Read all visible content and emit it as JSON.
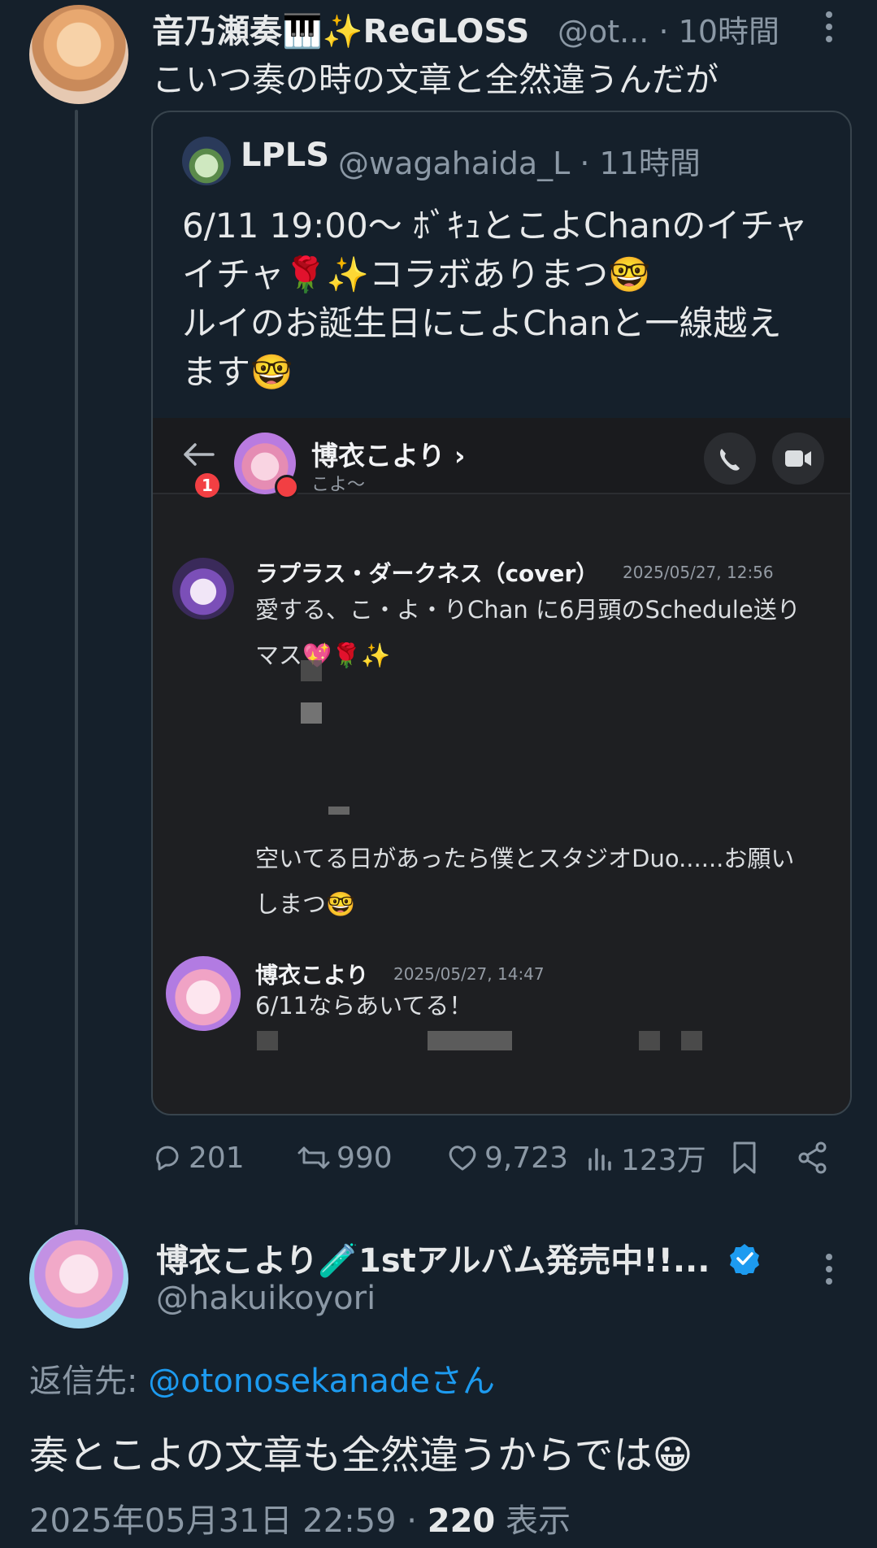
{
  "tweet1": {
    "display_name": "音乃瀬奏🎹✨ReGLOSS",
    "handle": "@ot...",
    "time": "· 10時間",
    "text": "こいつ奏の時の文章と全然違うんだが"
  },
  "quote": {
    "display_name": "LPLS",
    "handle": "@wagahaida_L · 11時間",
    "lines": [
      "6/11 19:00〜 ﾎﾞｷｭとこよChanのイチャ",
      "イチャ🌹✨コラボありまつ🤓",
      "ルイのお誕生日にこよChanと一線越え",
      "ます🤓"
    ]
  },
  "chat": {
    "badge": "1",
    "channel_name": "博衣こより ›",
    "channel_sub": "こよ〜",
    "msg1": {
      "name": "ラプラス・ダークネス（cover）",
      "time": "2025/05/27, 12:56",
      "lines": [
        "愛する、こ・よ・りChan に6月頭のSchedule送り",
        "マス💖🌹✨"
      ],
      "lines2": [
        "空いてる日があったら僕とスタジオDuo......お願い",
        "しまつ🤓"
      ]
    },
    "msg2": {
      "name": "博衣こより",
      "time": "2025/05/27, 14:47",
      "text": "6/11ならあいてる！"
    }
  },
  "actions": {
    "replies": "201",
    "retweets": "990",
    "likes": "9,723",
    "views": "123万"
  },
  "tweet2": {
    "display_name": "博衣こより🧪1stアルバム発売中!!...",
    "handle": "@hakuikoyori",
    "reply_prefix": "返信先: ",
    "reply_link": "@otonosekanadeさん",
    "text": "奏とこよの文章も全然違うからでは😀",
    "timestamp": "2025年05月31日 22:59 · ",
    "views_count": "220",
    "views_label": " 表示"
  },
  "colors": {
    "background": "#15202b",
    "link": "#1d9bf0",
    "muted": "#8b98a5",
    "verified": "#1d9bf0"
  }
}
